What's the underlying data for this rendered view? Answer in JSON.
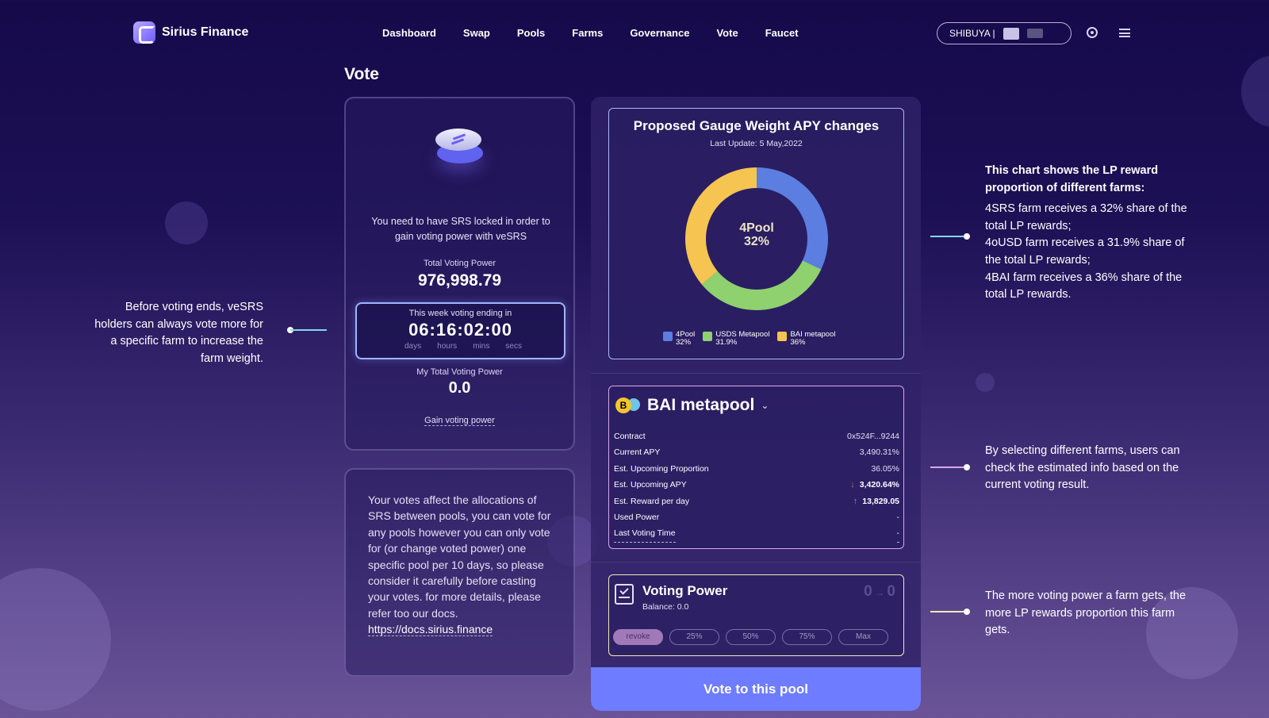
{
  "header": {
    "brand": "Sirius Finance",
    "nav": [
      "Dashboard",
      "Swap",
      "Pools",
      "Farms",
      "Governance",
      "Vote",
      "Faucet"
    ],
    "network_label": "SHIBUYA |"
  },
  "page": {
    "title": "Vote"
  },
  "lock_card": {
    "message": "You need to have SRS locked in order to gain voting power with veSRS",
    "total_voting_power_label": "Total Voting Power",
    "total_voting_power": "976,998.79",
    "countdown_label": "This week voting ending in",
    "countdown": "06:16:02:00",
    "units": [
      "days",
      "hours",
      "mins",
      "secs"
    ],
    "my_voting_power_label": "My Total Voting Power",
    "my_voting_power": "0.0",
    "gain_link": "Gain voting power"
  },
  "info_card": {
    "text": "Your votes affect the allocations of SRS between pools, you can vote for any pools however you can only vote for (or change voted power) one specific pool per 10 days, so please consider it carefully before casting your votes. for more details, please refer too our docs.",
    "link": "https://docs.sirius.finance"
  },
  "chart": {
    "title": "Proposed Gauge Weight APY changes",
    "subtitle": "Last Update: 5 May,2022",
    "center_label": "4Pool",
    "center_value": "32%"
  },
  "chart_data": {
    "type": "pie",
    "title": "Proposed Gauge Weight APY changes",
    "series": [
      {
        "name": "4Pool",
        "value": 32,
        "label": "32%",
        "color": "#5b7ee0"
      },
      {
        "name": "USDS Metapool",
        "value": 31.9,
        "label": "31.9%",
        "color": "#8fd16e"
      },
      {
        "name": "BAI metapool",
        "value": 36,
        "label": "36%",
        "color": "#f5c451"
      }
    ]
  },
  "farm": {
    "name": "BAI metapool",
    "rows": [
      {
        "label": "Contract",
        "value": "0x524F...9244"
      },
      {
        "label": "Current APY",
        "value": "3,490.31%"
      },
      {
        "label": "Est. Upcoming Proportion",
        "value": "36.05%"
      },
      {
        "label": "Est. Upcoming APY",
        "value": "3,420.64%"
      },
      {
        "label": "Est. Reward per day",
        "value": "13,829.05"
      },
      {
        "label": "Used Power",
        "value": "-"
      },
      {
        "label": "Last Voting Time",
        "value": "-"
      }
    ]
  },
  "voting_power": {
    "title": "Voting Power",
    "balance": "Balance: 0.0",
    "change_from": "0",
    "change_to": "0",
    "buttons": [
      "revoke",
      "25%",
      "50%",
      "75%",
      "Max"
    ]
  },
  "vote_button": "Vote to this pool",
  "annotations": {
    "left": "Before voting ends, veSRS holders can always vote more for a specific farm to increase the farm weight.",
    "chart_title": "This chart shows the LP reward proportion of different farms:",
    "chart_lines": [
      "4SRS farm receives a 32% share of the total LP rewards;",
      "4oUSD farm receives a 31.9% share of the total LP rewards;",
      "4BAI farm receives a 36% share of the total LP rewards."
    ],
    "farm": "By selecting different farms, users can check the estimated info based on the current voting result.",
    "power": "The more voting power a farm gets, the more LP rewards proportion this farm gets."
  },
  "colors": {
    "accent": "#6e7cff",
    "line_cyan": "#7fd8e8",
    "line_pink": "#d8a7e8",
    "line_yellow": "#f0e9b8"
  }
}
